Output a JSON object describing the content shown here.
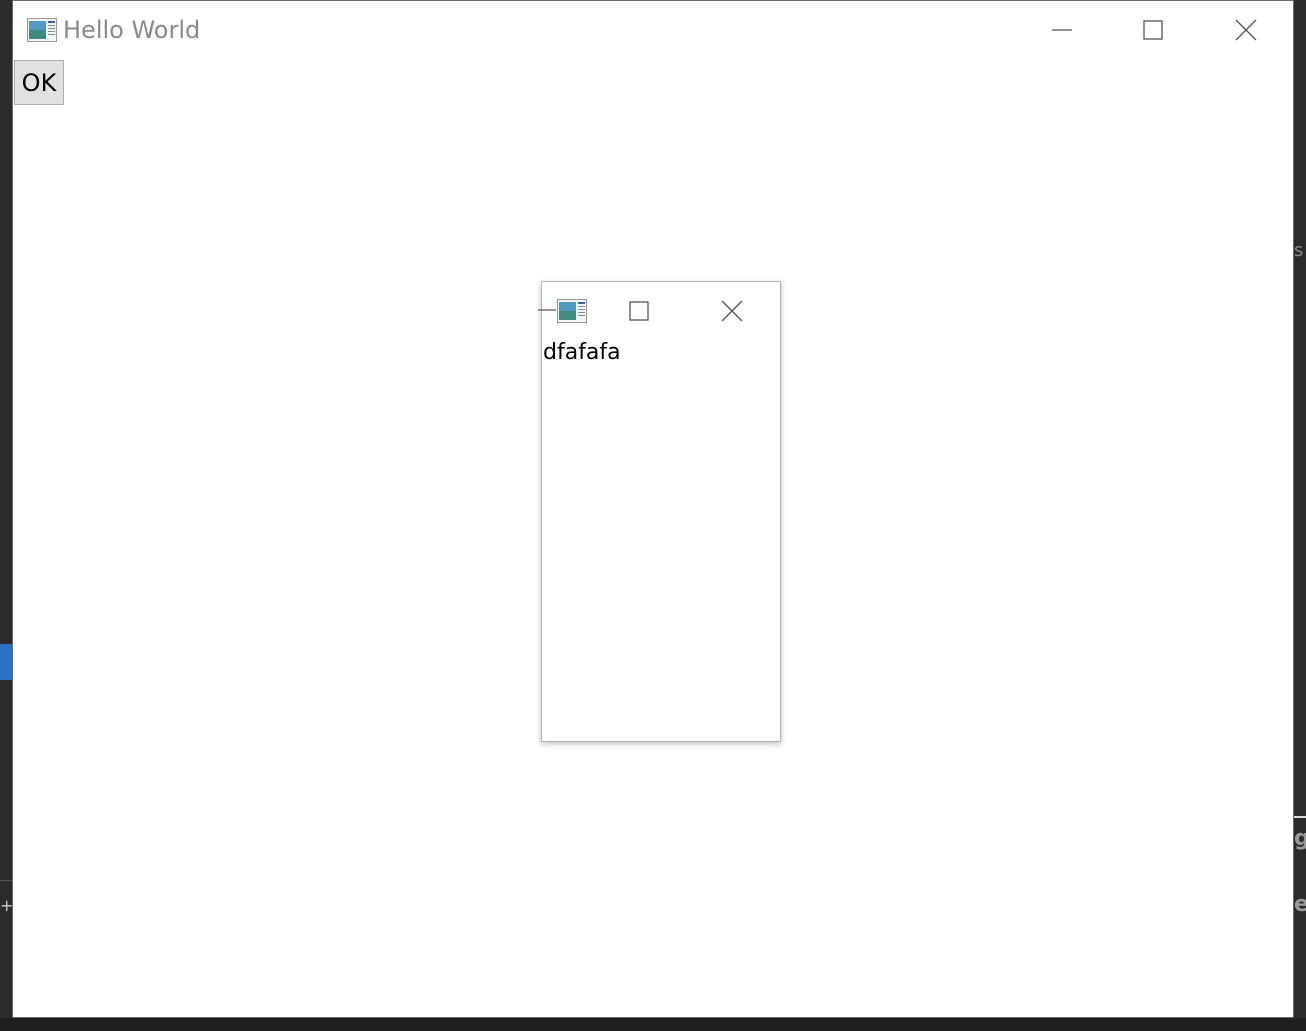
{
  "main_window": {
    "title": "Hello World",
    "ok_button_label": "OK",
    "controls": {
      "minimize_icon": "minimize-icon",
      "maximize_icon": "maximize-icon",
      "close_icon": "close-icon"
    }
  },
  "child_window": {
    "content_text": "dfafafa",
    "controls": {
      "minimize_icon": "minimize-icon",
      "maximize_icon": "maximize-icon",
      "close_icon": "close-icon"
    }
  },
  "colors": {
    "title_text": "#8a8a8a",
    "button_face": "#e1e1e1",
    "window_bg": "#ffffff",
    "accent_blue": "#2d6fc4"
  }
}
